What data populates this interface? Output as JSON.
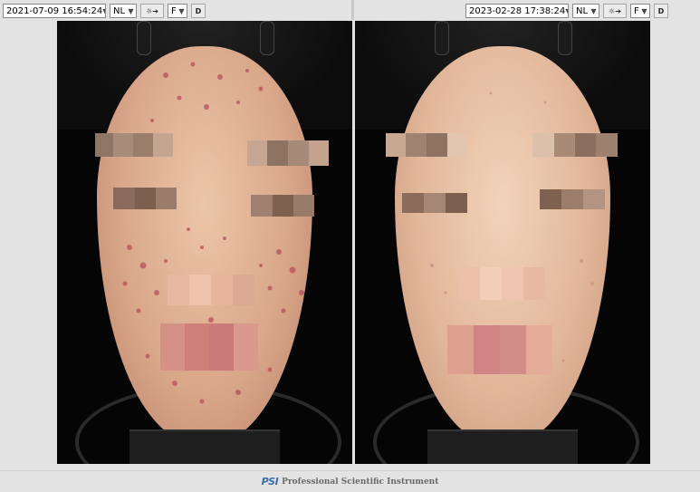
{
  "left_panel": {
    "datetime": "2021-07-09 16:54:24",
    "mode": "NL",
    "light_icon": "light-arrow-icon",
    "view": "F",
    "d_label": "D"
  },
  "right_panel": {
    "datetime": "2023-02-28 17:38:24",
    "mode": "NL",
    "light_icon": "light-arrow-icon",
    "view": "F",
    "d_label": "D"
  },
  "footer": {
    "logo_text": "PSI",
    "company": "Professional Scientific Instrument"
  }
}
